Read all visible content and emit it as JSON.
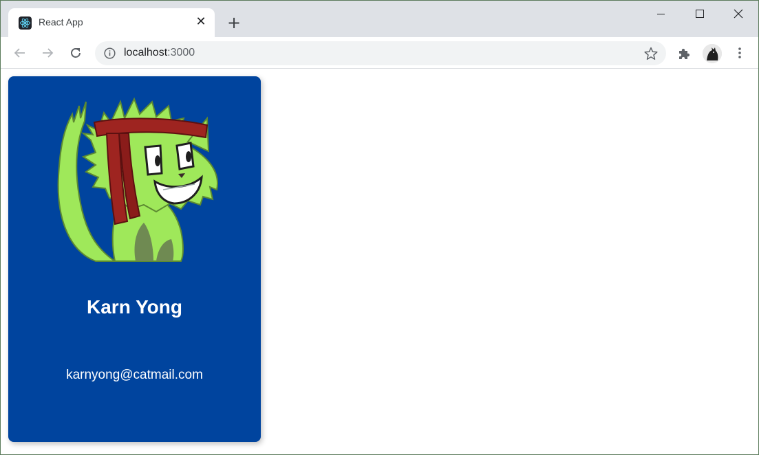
{
  "browser": {
    "tab": {
      "title": "React App",
      "favicon": "react-logo-icon",
      "close_glyph": "✕"
    },
    "new_tab_glyph": "+",
    "address": {
      "host": "localhost",
      "port": ":3000"
    },
    "icons": {
      "back": "arrow-left-icon",
      "forward": "arrow-right-icon",
      "reload": "reload-icon",
      "site_info": "info-icon",
      "bookmark": "star-icon",
      "extensions": "puzzle-icon",
      "profile": "avatar",
      "menu": "kebab-menu-icon"
    },
    "colors": {
      "tabstrip": "#dee1e6",
      "toolbar": "#ffffff",
      "omnibox": "#f1f3f4"
    }
  },
  "card": {
    "image": "green-cat-headband-illustration",
    "name": "Karn Yong",
    "email": "karnyong@catmail.com",
    "colors": {
      "background": "#00449e",
      "text": "#ffffff",
      "cat_green": "#9fe85a",
      "headband": "#9e2420"
    }
  }
}
